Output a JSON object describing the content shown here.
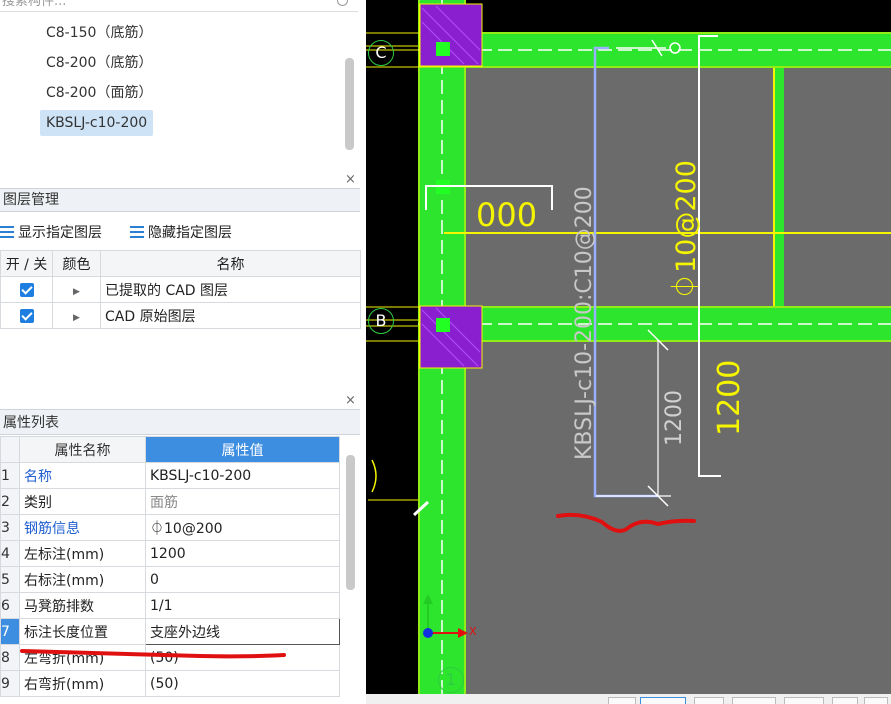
{
  "search": {
    "placeholder": "搜索构件..."
  },
  "tree": {
    "items": [
      {
        "label": "C8-150（底筋）"
      },
      {
        "label": "C8-200（底筋）"
      },
      {
        "label": "C8-200（面筋）"
      },
      {
        "label": "KBSLJ-c10-200",
        "selected": true
      }
    ]
  },
  "layer_panel": {
    "title": "图层管理",
    "close": "×",
    "show_btn": "显示指定图层",
    "hide_btn": "隐藏指定图层",
    "columns": [
      "开 / 关",
      "颜色",
      "名称"
    ],
    "rows": [
      {
        "name": "已提取的 CAD 图层",
        "checked": true
      },
      {
        "name": "CAD 原始图层",
        "checked": true
      }
    ]
  },
  "prop_panel": {
    "title": "属性列表",
    "close": "×",
    "columns": [
      "属性名称",
      "属性值"
    ],
    "rows": [
      {
        "num": "1",
        "name": "名称",
        "value": "KBSLJ-c10-200"
      },
      {
        "num": "2",
        "name": "类别",
        "value": "面筋"
      },
      {
        "num": "3",
        "name": "钢筋信息",
        "value": "⏀10@200"
      },
      {
        "num": "4",
        "name": "左标注(mm)",
        "value": "1200"
      },
      {
        "num": "5",
        "name": "右标注(mm)",
        "value": "0"
      },
      {
        "num": "6",
        "name": "马凳筋排数",
        "value": "1/1"
      },
      {
        "num": "7",
        "name": "标注长度位置",
        "value": "支座外边线"
      },
      {
        "num": "8",
        "name": "左弯折(mm)",
        "value": "(50)"
      },
      {
        "num": "9",
        "name": "右弯折(mm)",
        "value": "(50)"
      }
    ]
  },
  "cad": {
    "axis_c": "C",
    "axis_b": "B",
    "axis_1": "1",
    "rebar_label": "KBSLJ-c10-200:C10@200",
    "spec_label": "⏀10@200",
    "dim_1200_gray": "1200",
    "dim_1200_yellow": "1200",
    "partial_text": "000",
    "axis_x": "X",
    "colors": {
      "beam": "#2ee52e",
      "slab": "#6b6b6b",
      "column": "#8a1fd0",
      "rebar": "#9ab0ff",
      "dim": "#f5f500"
    }
  }
}
